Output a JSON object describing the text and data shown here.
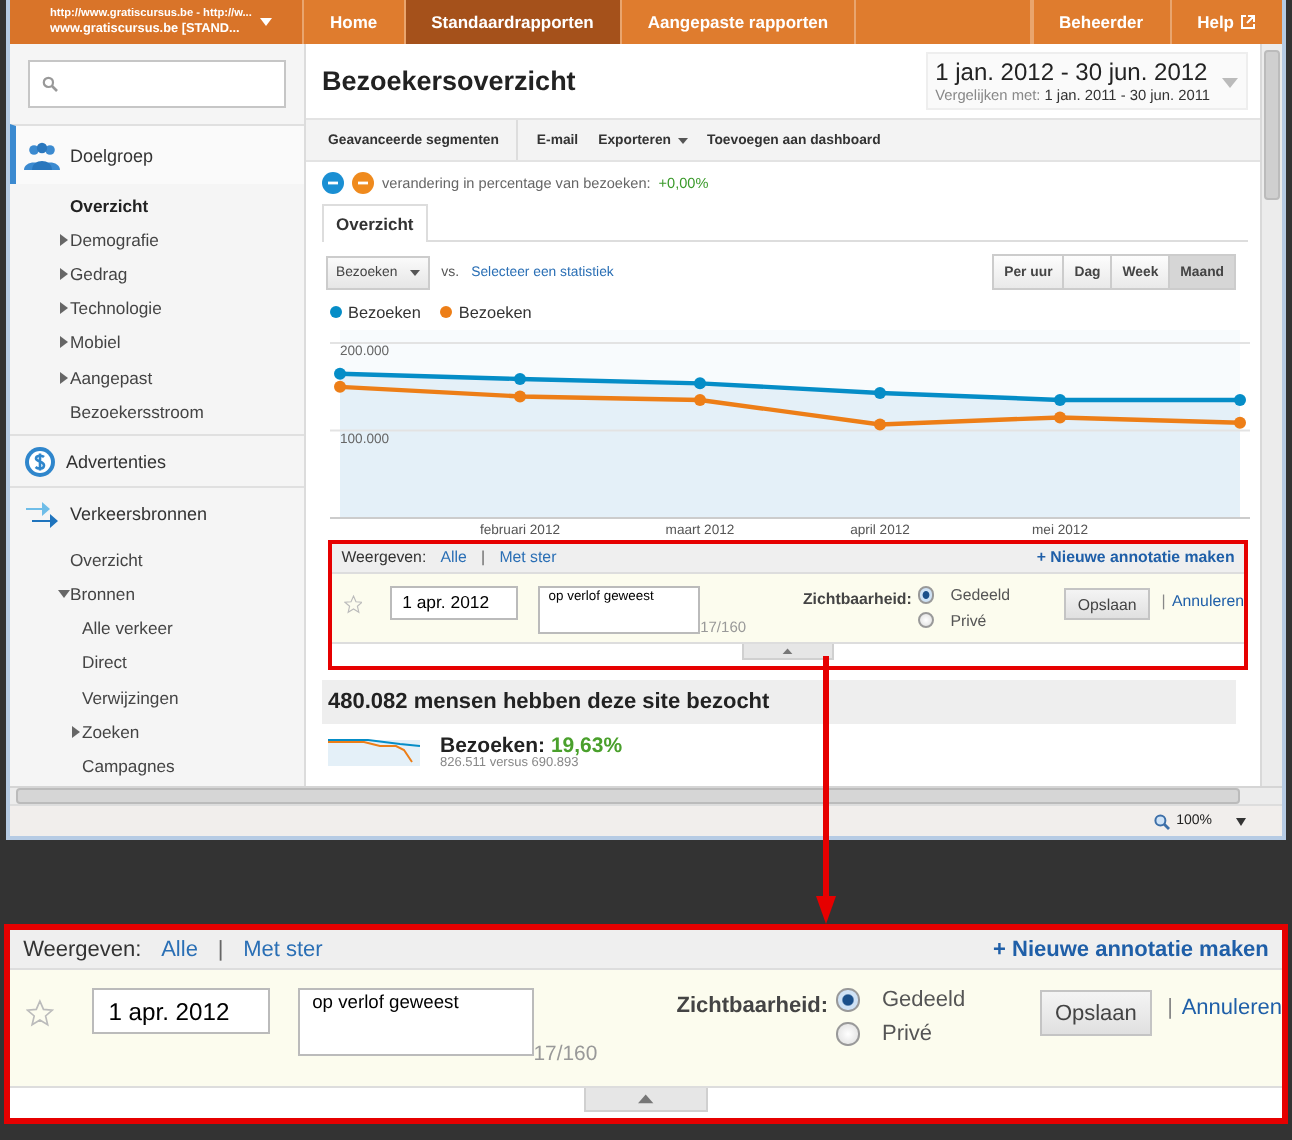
{
  "browser": {
    "address": "http://www.gratiscursus.be - http://w...",
    "account": "www.gratiscursus.be [STAND...",
    "zoom": "100%"
  },
  "nav": {
    "tabs": [
      {
        "label": "Home",
        "selected": false
      },
      {
        "label": "Standaardrapporten",
        "selected": true
      },
      {
        "label": "Aangepaste rapporten",
        "selected": false
      }
    ],
    "right_tabs": [
      {
        "label": "Beheerder",
        "kind": "plain"
      },
      {
        "label": "Help",
        "kind": "external"
      }
    ]
  },
  "sidebar": {
    "sections": [
      {
        "label": "Doelgroep",
        "selected": true,
        "items": [
          {
            "label": "Overzicht",
            "selected": true
          },
          {
            "label": "Demografie",
            "selected": false,
            "expanded": false
          },
          {
            "label": "Gedrag",
            "selected": false,
            "expanded": false
          },
          {
            "label": "Technologie",
            "selected": false,
            "expanded": false
          },
          {
            "label": "Mobiel",
            "selected": false,
            "expanded": false
          },
          {
            "label": "Aangepast",
            "selected": false,
            "expanded": false
          },
          {
            "label": "Bezoekersstroom",
            "selected": false
          }
        ]
      },
      {
        "label": "Advertenties",
        "selected": false
      },
      {
        "label": "Verkeersbronnen",
        "selected": false,
        "items": [
          {
            "label": "Overzicht",
            "selected": false
          },
          {
            "label": "Bronnen",
            "selected": false,
            "expanded": true,
            "children": [
              {
                "label": "Alle verkeer",
                "selected": false
              },
              {
                "label": "Direct",
                "selected": false
              },
              {
                "label": "Verwijzingen",
                "selected": false
              },
              {
                "label": "Zoeken",
                "selected": false,
                "expanded": false
              },
              {
                "label": "Campagnes",
                "selected": false
              }
            ]
          }
        ]
      }
    ]
  },
  "report": {
    "title": "Bezoekersoverzicht",
    "date_range": "1 jan. 2012 - 30 jun. 2012",
    "compare_label": "Vergelijken met:",
    "compare_range": "1 jan. 2011 - 30 jun. 2011",
    "toolbar": [
      {
        "label": "Geavanceerde segmenten",
        "kind": "plain"
      },
      {
        "label": "E-mail",
        "kind": "plain"
      },
      {
        "label": "Exporteren",
        "kind": "menu"
      },
      {
        "label": "Toevoegen aan dashboard",
        "kind": "plain"
      }
    ],
    "segment": {
      "text": "verandering in percentage van bezoeken:",
      "value": "+0,00%"
    },
    "tabs": [
      {
        "label": "Overzicht",
        "selected": true
      }
    ],
    "metric_select": "Bezoeken",
    "vs": "vs.",
    "second_metric": "Selecteer een statistiek",
    "periods": [
      {
        "label": "Per uur",
        "selected": false
      },
      {
        "label": "Dag",
        "selected": false
      },
      {
        "label": "Week",
        "selected": false
      },
      {
        "label": "Maand",
        "selected": true
      }
    ],
    "chart_data": {
      "type": "line",
      "categories": [
        null,
        "februari 2012",
        "maart 2012",
        "april 2012",
        "mei 2012",
        null
      ],
      "ylim": [
        0,
        215000
      ],
      "yticks": [
        {
          "value": 100000,
          "label": "100.000"
        },
        {
          "value": 200000,
          "label": "200.000"
        }
      ],
      "series": [
        {
          "name": "Bezoeken",
          "color": "#058dc7",
          "marker": "circle",
          "type": "area",
          "values": [
            165000,
            159000,
            154000,
            143000,
            135000,
            135000
          ]
        },
        {
          "name": "Bezoeken",
          "color": "#ed7e17",
          "marker": "circle",
          "type": "line",
          "values": [
            150000,
            139000,
            135000,
            107000,
            115000,
            109000
          ]
        }
      ]
    },
    "annotations": {
      "show_label": "Weergeven:",
      "filters": [
        "Alle",
        "Met ster"
      ],
      "separator": "|",
      "new_link": "+ Nieuwe annotatie maken",
      "starred": false,
      "date": "1 apr. 2012",
      "text": "op verlof geweest",
      "counter": "17/160",
      "visibility_label": "Zichtbaarheid:",
      "visibility": [
        {
          "label": "Gedeeld",
          "selected": true
        },
        {
          "label": "Privé",
          "selected": false
        }
      ],
      "save": "Opslaan",
      "cancel_separator": "|",
      "cancel": "Annuleren"
    },
    "summary": {
      "headline": "480.082 mensen hebben deze site bezocht",
      "metric_label": "Bezoeken:",
      "metric_value": "19,63%",
      "comparison": "826.511 versus 690.893"
    }
  },
  "zoomed_annotations": {
    "show_label": "Weergeven:",
    "filters": [
      "Alle",
      "Met ster"
    ],
    "separator": "|",
    "new_link": "+ Nieuwe annotatie maken",
    "starred": false,
    "date": "1 apr. 2012",
    "text": "op verlof geweest",
    "counter": "17/160",
    "visibility_label": "Zichtbaarheid:",
    "visibility": [
      {
        "label": "Gedeeld",
        "selected": true
      },
      {
        "label": "Privé",
        "selected": false
      }
    ],
    "save": "Opslaan",
    "cancel_separator": "|",
    "cancel": "Annuleren"
  }
}
